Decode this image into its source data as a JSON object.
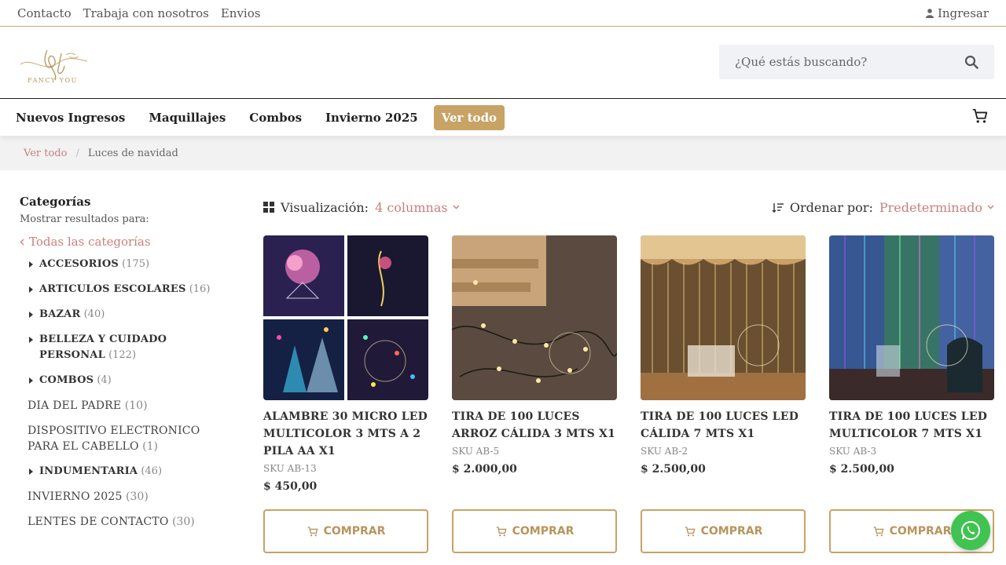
{
  "topbar": {
    "links": [
      "Contacto",
      "Trabaja con nosotros",
      "Envios"
    ],
    "login": "Ingresar"
  },
  "header": {
    "logo_text": "FANCY YOU",
    "search_placeholder": "¿Qué estás buscando?"
  },
  "nav": {
    "items": [
      "Nuevos Ingresos",
      "Maquillajes",
      "Combos",
      "Invierno 2025"
    ],
    "button": "Ver todo"
  },
  "breadcrumb": {
    "root": "Ver todo",
    "separator": "/",
    "current": "Luces de navidad"
  },
  "sidebar": {
    "title": "Categorías",
    "note": "Mostrar resultados para:",
    "all_link": "Todas las categorías",
    "categories": [
      {
        "name": "ACCESORIOS",
        "count": "(175)"
      },
      {
        "name": "ARTICULOS ESCOLARES",
        "count": "(16)"
      },
      {
        "name": "BAZAR",
        "count": "(40)"
      },
      {
        "name": "BELLEZA Y CUIDADO PERSONAL",
        "count": "(122)"
      },
      {
        "name": "COMBOS",
        "count": "(4)"
      },
      {
        "name": "DIA DEL PADRE",
        "count": "(10)"
      },
      {
        "name": "DISPOSITIVO ELECTRONICO PARA EL CABELLO",
        "count": "(1)"
      },
      {
        "name": "INDUMENTARIA",
        "count": "(46)"
      },
      {
        "name": "INVIERNO 2025",
        "count": "(30)"
      },
      {
        "name": "LENTES DE CONTACTO",
        "count": "(30)"
      }
    ]
  },
  "toolbar": {
    "view_label": "Visualización:",
    "view_value": "4 columnas",
    "sort_label": "Ordenar por:",
    "sort_value": "Predeterminado"
  },
  "products": [
    {
      "title": "ALAMBRE 30 MICRO LED MULTICOLOR 3 MTS A 2 PILA AA X1",
      "sku": "SKU AB-13",
      "price": "$  450,00",
      "button": "COMPRAR"
    },
    {
      "title": "TIRA DE 100 LUCES ARROZ CÁLIDA 3 MTS X1",
      "sku": "SKU AB-5",
      "price": "$  2.000,00",
      "button": "COMPRAR"
    },
    {
      "title": "TIRA DE 100 LUCES LED CÁLIDA 7 MTS X1",
      "sku": "SKU AB-2",
      "price": "$  2.500,00",
      "button": "COMPRAR"
    },
    {
      "title": "TIRA DE 100 LUCES LED MULTICOLOR 7 MTS X1",
      "sku": "SKU AB-3",
      "price": "$  2.500,00",
      "button": "COMPRAR"
    }
  ],
  "colors": {
    "accent_gold": "#c8a366",
    "link_rose": "#c9807d",
    "whatsapp_green": "#40c351"
  }
}
